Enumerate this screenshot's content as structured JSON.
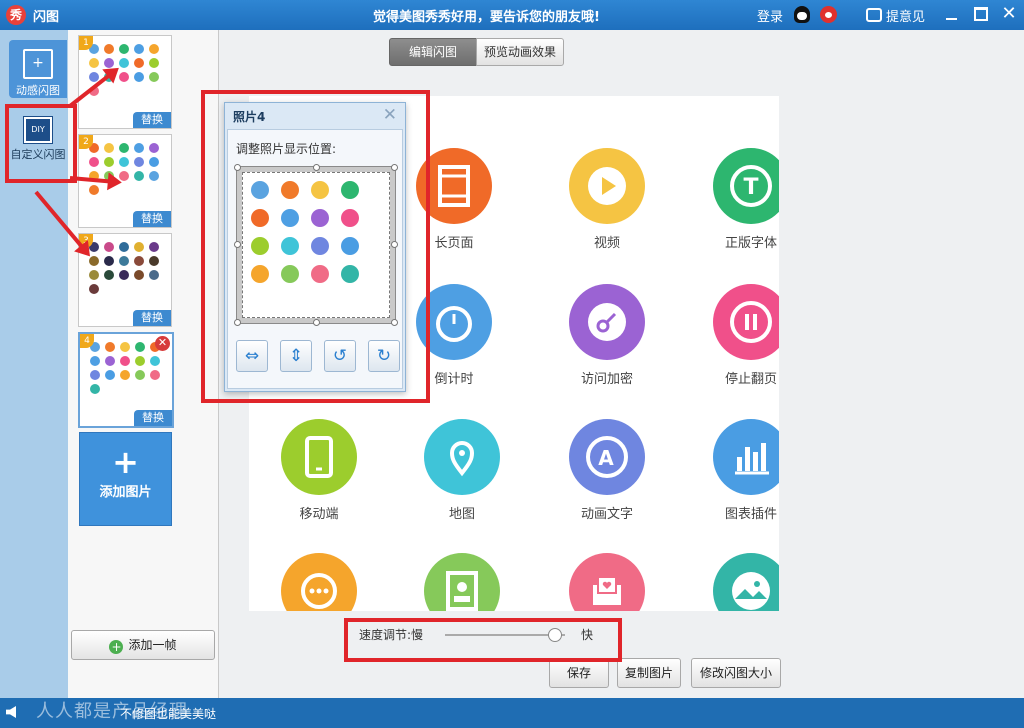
{
  "window": {
    "app_title": "闪图",
    "app_icon_text": "秀",
    "slogan": "觉得美图秀秀好用，要告诉您的朋友哦!",
    "login": "登录",
    "feedback": "提意见"
  },
  "modes": [
    {
      "label": "动感闪图",
      "active": true
    },
    {
      "label": "自定义闪图",
      "active": false,
      "badge": "DIY"
    }
  ],
  "thumbnails": [
    {
      "number": "1",
      "replace_label": "替换"
    },
    {
      "number": "2",
      "replace_label": "替换"
    },
    {
      "number": "3",
      "replace_label": "替换"
    },
    {
      "number": "4",
      "replace_label": "替换",
      "selected": true
    }
  ],
  "add_image": {
    "plus": "+",
    "label": "添加图片"
  },
  "add_frame": {
    "label": "添加一帧"
  },
  "tabs": [
    {
      "label": "编辑闪图",
      "active": true
    },
    {
      "label": "预览动画效果",
      "active": false
    }
  ],
  "stage": {
    "features": [
      {
        "label": "长页面",
        "color": "#f06a28",
        "icon": "long-page-icon"
      },
      {
        "label": "视频",
        "color": "#f5c443",
        "icon": "video-play-icon"
      },
      {
        "label": "正版字体",
        "color": "#2db66f",
        "icon": "font-t-icon"
      },
      {
        "label": "倒计时",
        "color": "#4e9fe3",
        "icon": "stopwatch-icon"
      },
      {
        "label": "访问加密",
        "color": "#9b63d3",
        "icon": "key-icon"
      },
      {
        "label": "停止翻页",
        "color": "#f0508a",
        "icon": "pause-icon"
      },
      {
        "label": "移动端",
        "color": "#9ccd2d",
        "icon": "mobile-icon"
      },
      {
        "label": "地图",
        "color": "#3fc4d8",
        "icon": "map-pin-icon"
      },
      {
        "label": "动画文字",
        "color": "#6f86e0",
        "icon": "animated-text-icon"
      },
      {
        "label": "图表插件",
        "color": "#4a9de3",
        "icon": "bar-chart-icon"
      },
      {
        "label": "",
        "color": "#f5a52c",
        "icon": "chat-bubble-icon"
      },
      {
        "label": "",
        "color": "#86c95a",
        "icon": "contact-card-icon"
      },
      {
        "label": "",
        "color": "#f06b86",
        "icon": "envelope-heart-icon"
      },
      {
        "label": "",
        "color": "#33b5a7",
        "icon": "landscape-icon"
      }
    ]
  },
  "photo_panel": {
    "title": "照片4",
    "hint": "调整照片显示位置:",
    "mini_colors": [
      "#5aa3e0",
      "#f07a2a",
      "#f5c443",
      "#2db66f",
      "#f06a28",
      "#4e9fe3",
      "#9b63d3",
      "#f0508a",
      "#9ccd2d",
      "#3fc4d8",
      "#6f86e0",
      "#4a9de3",
      "#f5a52c",
      "#86c95a",
      "#f06b86",
      "#33b5a7"
    ]
  },
  "speed": {
    "label": "速度调节:",
    "slow": "慢",
    "fast": "快",
    "value_fraction": 0.9
  },
  "buttons": {
    "save": "保存",
    "copy": "复制图片",
    "resize": "修改闪图大小"
  },
  "status": {
    "tip": "不修图也能美美哒",
    "watermark": "人人都是产品经理"
  },
  "thumb_colors": [
    [
      "#5aa3e0",
      "#f07a2a",
      "#2db66f",
      "#4e9fe3",
      "#f5a52c",
      "#f5c443",
      "#9b63d3",
      "#3fc4d8",
      "#f06a28",
      "#9ccd2d",
      "#6f86e0",
      "#33b5a7",
      "#f0508a",
      "#4a9de3",
      "#86c95a",
      "#f06b86"
    ],
    [
      "#f06a28",
      "#f5c443",
      "#2db66f",
      "#4e9fe3",
      "#9b63d3",
      "#f0508a",
      "#9ccd2d",
      "#3fc4d8",
      "#6f86e0",
      "#4a9de3",
      "#f5a52c",
      "#86c95a",
      "#f06b86",
      "#33b5a7",
      "#5aa3e0",
      "#f07a2a"
    ],
    [
      "#3a3a6a",
      "#c94a8a",
      "#2f6c9a",
      "#e0b030",
      "#6a3a8a",
      "#8a6a2a",
      "#2a2a4a",
      "#3d7a9a",
      "#8a4a3a",
      "#4a3a2a",
      "#9a8a3a",
      "#2a4a3a",
      "#3a2a5a",
      "#7a4a2a",
      "#4a6a8a",
      "#6a3a3a"
    ],
    [
      "#5aa3e0",
      "#f07a2a",
      "#f5c443",
      "#2db66f",
      "#f06a28",
      "#4e9fe3",
      "#9b63d3",
      "#f0508a",
      "#9ccd2d",
      "#3fc4d8",
      "#6f86e0",
      "#4a9de3",
      "#f5a52c",
      "#86c95a",
      "#f06b86",
      "#33b5a7"
    ]
  ]
}
